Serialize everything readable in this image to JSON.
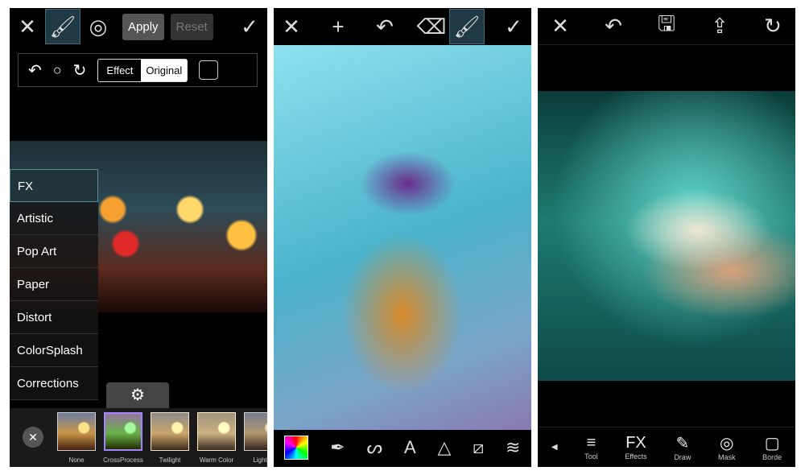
{
  "panel1": {
    "apply": "Apply",
    "reset": "Reset",
    "effect": "Effect",
    "original": "Original",
    "menu": [
      "FX",
      "Artistic",
      "Pop Art",
      "Paper",
      "Distort",
      "ColorSplash",
      "Corrections"
    ],
    "thumbs": [
      "None",
      "CrossProcess",
      "Twilight",
      "Warm Color",
      "Light C"
    ]
  },
  "panel2": {
    "tools": [
      "color-picker-icon",
      "eyedropper-icon",
      "brush-stroke-icon",
      "A",
      "shapes-icon",
      "image-add-icon",
      "layers-icon"
    ]
  },
  "panel3": {
    "tools": [
      {
        "icon": "≡",
        "label": "Tool"
      },
      {
        "icon": "FX",
        "label": "Effects"
      },
      {
        "icon": "✎",
        "label": "Draw"
      },
      {
        "icon": "◎",
        "label": "Mask"
      },
      {
        "icon": "▢",
        "label": "Borde"
      }
    ]
  },
  "colors": {
    "accent": "#3aa7d8",
    "selected": "#1f3a44"
  }
}
